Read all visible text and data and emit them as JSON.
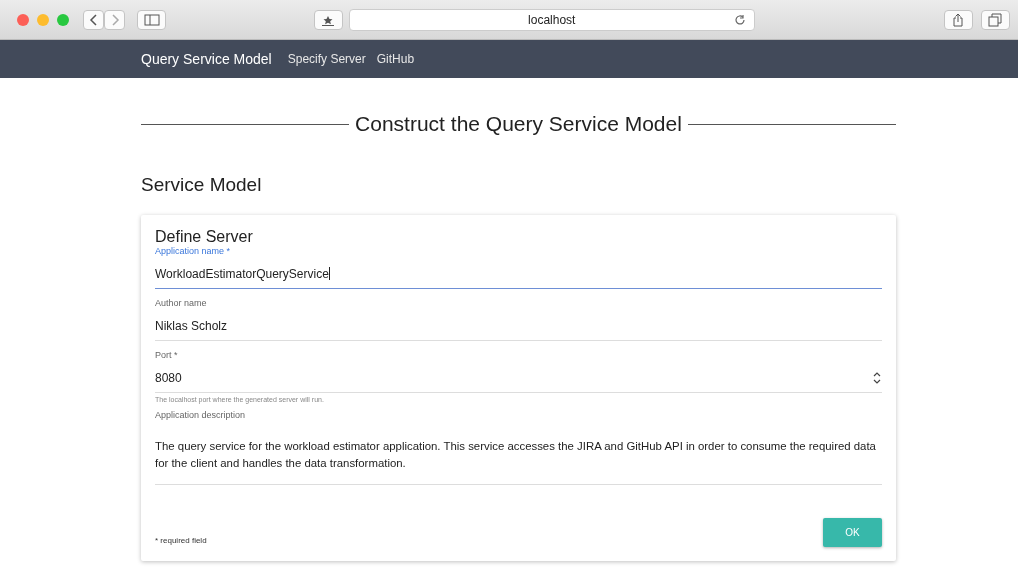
{
  "browser": {
    "address": "localhost"
  },
  "navbar": {
    "brand": "Query Service Model",
    "links": [
      "Specify Server",
      "GitHub"
    ]
  },
  "page_title": "Construct the Query Service Model",
  "section_title": "Service Model",
  "card": {
    "title": "Define Server",
    "fields": [
      {
        "kind": "text",
        "label": "Application name *",
        "value": "WorkloadEstimatorQueryService",
        "focused": true
      },
      {
        "kind": "text",
        "label": "Author name",
        "value": "Niklas Scholz",
        "focused": false
      },
      {
        "kind": "number",
        "label": "Port *",
        "value": "8080",
        "hint": "The localhost port where the generated server will run.",
        "focused": false
      },
      {
        "kind": "textarea",
        "label": "Application description",
        "value": "The query service for the workload estimator application. This service accesses the JIRA and GitHub API in order to consume the required data for the client and handles the data transformation.",
        "focused": false
      }
    ],
    "note": "* required field",
    "button": "OK"
  }
}
